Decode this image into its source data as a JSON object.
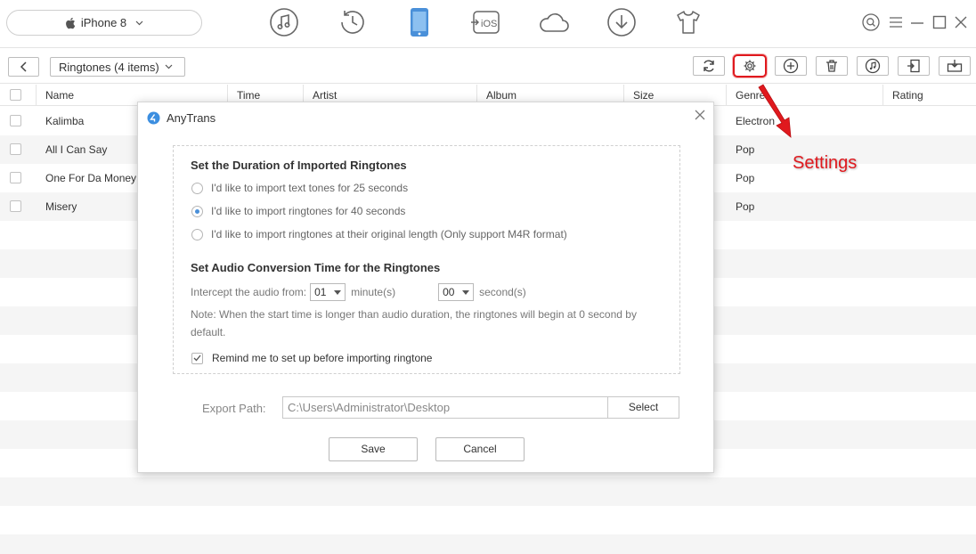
{
  "device": {
    "name": "iPhone 8"
  },
  "nav_icons": [
    "music-icon",
    "history-icon",
    "phone-icon",
    "to-ios-icon",
    "cloud-icon",
    "download-icon",
    "shirt-icon"
  ],
  "nav_ios_label": "iOS",
  "toolbar": {
    "category": "Ringtones (4 items)"
  },
  "columns": [
    "Name",
    "Time",
    "Artist",
    "Album",
    "Size",
    "Genre",
    "Rating"
  ],
  "rows": [
    {
      "name": "Kalimba",
      "genre": "Electron"
    },
    {
      "name": "All I Can Say",
      "genre": "Pop"
    },
    {
      "name": "One For Da Money",
      "genre": "Pop"
    },
    {
      "name": "Misery",
      "genre": "Pop"
    }
  ],
  "dialog": {
    "title": "AnyTrans",
    "duration_title": "Set the Duration of Imported Ringtones",
    "options": [
      {
        "label": "I'd like to import text tones for 25 seconds",
        "selected": false
      },
      {
        "label": "I'd like to import ringtones for 40 seconds",
        "selected": true
      },
      {
        "label": "I'd like to import ringtones at their original length (Only support M4R format)",
        "selected": false
      }
    ],
    "conversion_title": "Set Audio Conversion Time for the Ringtones",
    "intercept_label": "Intercept the audio from:",
    "minute_value": "01",
    "minute_label": "minute(s)",
    "second_value": "00",
    "second_label": "second(s)",
    "note": "Note: When the start time is longer than audio duration, the ringtones will begin at 0 second by default.",
    "remind_label": "Remind me to set up before importing ringtone",
    "remind_checked": true,
    "export_label": "Export Path:",
    "export_path": "C:\\Users\\Administrator\\Desktop",
    "select_label": "Select",
    "save_label": "Save",
    "cancel_label": "Cancel"
  },
  "annotation": {
    "label": "Settings",
    "color": "#e0191e"
  },
  "colors": {
    "accent": "#4a90d9",
    "highlight": "#e0191e"
  }
}
